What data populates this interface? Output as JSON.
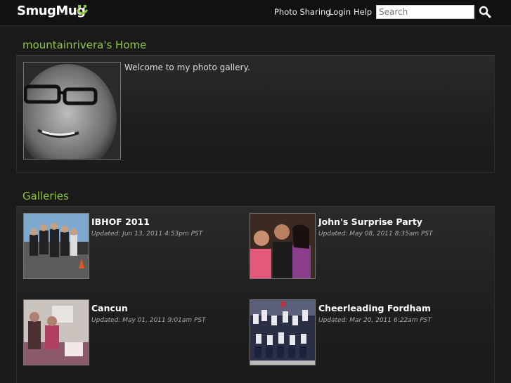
{
  "header": {
    "logo": "SmugMug",
    "nav": [
      "Photo Sharing",
      "Login",
      "Help"
    ],
    "search_placeholder": "Search"
  },
  "home": {
    "title": "mountainrivera's Home",
    "welcome": "Welcome to my photo gallery."
  },
  "galleries": {
    "title": "Galleries",
    "items": [
      {
        "name": "IBHOF 2011",
        "updated": "Updated: Jun 13, 2011 4:53pm PST"
      },
      {
        "name": "John's Surprise Party",
        "updated": "Updated: May 08, 2011 8:35am PST"
      },
      {
        "name": "Cancun",
        "updated": "Updated: May 01, 2011 9:01am PST"
      },
      {
        "name": "Cheerleading Fordham",
        "updated": "Updated: Mar 20, 2011 6:22am PST"
      }
    ]
  }
}
